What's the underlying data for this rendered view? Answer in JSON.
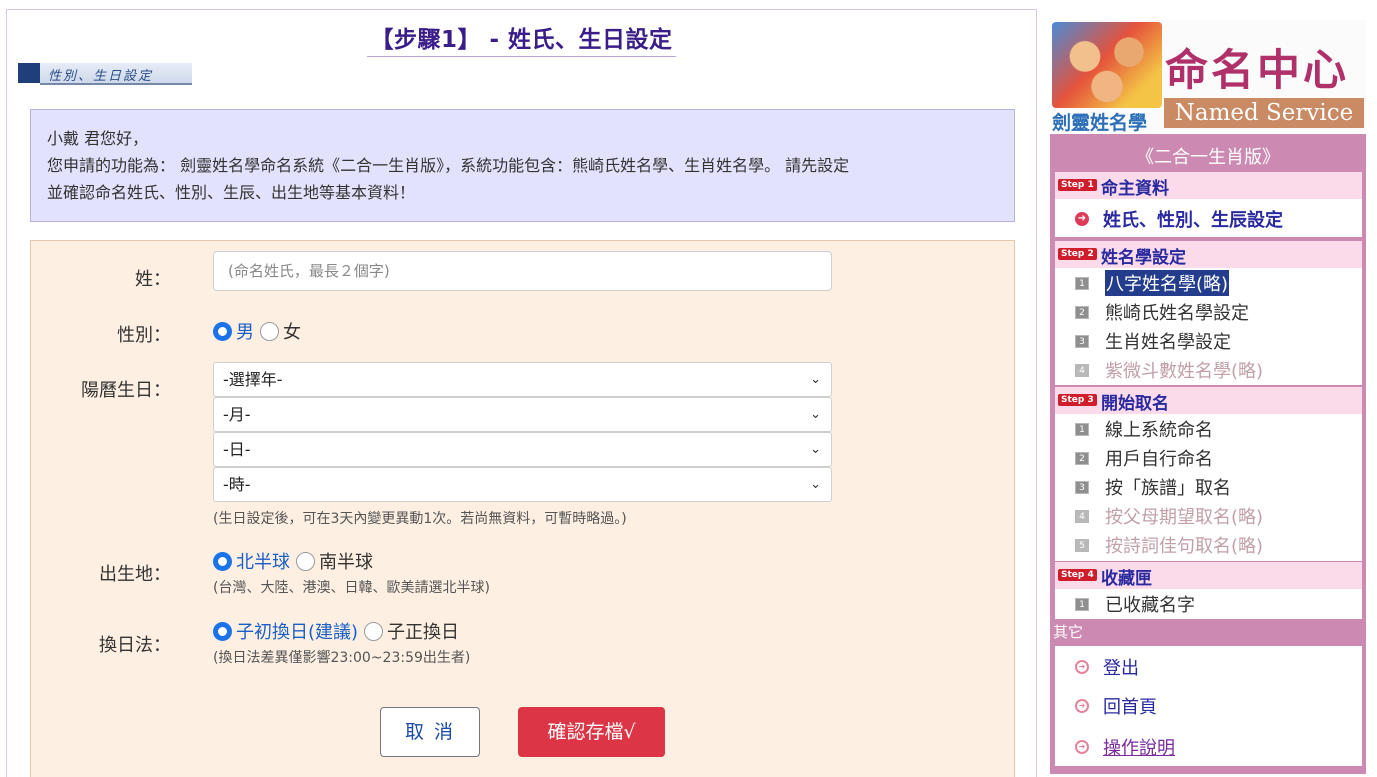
{
  "page_title": "【步驟1】 - 姓氏、生日設定",
  "section_banner": "性別、生日設定",
  "intro": {
    "line1": "小戴 君您好，",
    "line2": "您申請的功能為： 劍靈姓名學命名系統《二合一生肖版》，系統功能包含：熊崎氏姓名學、生肖姓名學。 請先設定",
    "line3": "並確認命名姓氏、性別、生辰、出生地等基本資料！"
  },
  "form": {
    "surname_label": "姓：",
    "surname_placeholder": "(命名姓氏，最長２個字)",
    "gender_label": "性別：",
    "gender_options": [
      "男",
      "女"
    ],
    "gender_selected": "男",
    "birthday_label": "陽曆生日：",
    "year_select": "-選擇年-",
    "month_select": "-月-",
    "day_select": "-日-",
    "hour_select": "-時-",
    "birthday_hint": "(生日設定後，可在3天內變更異動1次。若尚無資料，可暫時略過。)",
    "birthplace_label": "出生地：",
    "birthplace_options": [
      "北半球",
      "南半球"
    ],
    "birthplace_selected": "北半球",
    "birthplace_hint": "(台灣、大陸、港澳、日韓、歐美請選北半球)",
    "dayswitch_label": "換日法：",
    "dayswitch_options": [
      "子初換日(建議)",
      "子正換日"
    ],
    "dayswitch_selected": "子初換日(建議)",
    "dayswitch_hint": "(換日法差異僅影響23:00~23:59出生者)",
    "cancel_button": "取 消",
    "save_button": "確認存檔√"
  },
  "sidebar": {
    "logo_title": "命名中心",
    "logo_subtitle": "Named Service",
    "logo_mini": "劍靈姓名學",
    "edition": "《二合一生肖版》",
    "step1": {
      "tag": "Step 1",
      "label": "命主資料",
      "items": [
        "姓氏、性別、生辰設定"
      ]
    },
    "step2": {
      "tag": "Step 2",
      "label": "姓名學設定",
      "items": [
        {
          "num": "1",
          "label": "八字姓名學(略)"
        },
        {
          "num": "2",
          "label": "熊崎氏姓名學設定"
        },
        {
          "num": "3",
          "label": "生肖姓名學設定"
        },
        {
          "num": "4",
          "label": "紫微斗數姓名學(略)"
        }
      ]
    },
    "step3": {
      "tag": "Step 3",
      "label": "開始取名",
      "items": [
        {
          "num": "1",
          "label": "線上系統命名"
        },
        {
          "num": "2",
          "label": "用戶自行命名"
        },
        {
          "num": "3",
          "label": "按「族譜」取名"
        },
        {
          "num": "4",
          "label": "按父母期望取名(略)"
        },
        {
          "num": "5",
          "label": "按詩詞佳句取名(略)"
        }
      ]
    },
    "step4": {
      "tag": "Step 4",
      "label": "收藏匣",
      "items": [
        {
          "num": "1",
          "label": "已收藏名字"
        }
      ]
    },
    "other_label": "其它",
    "other_items": [
      "登出",
      "回首頁",
      "操作說明"
    ]
  }
}
